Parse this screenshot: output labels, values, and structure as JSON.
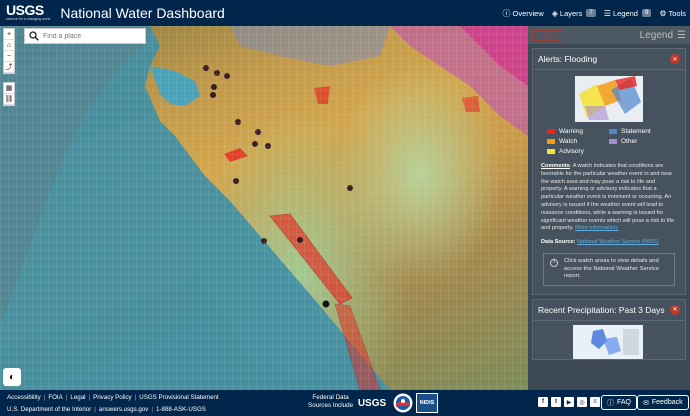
{
  "header": {
    "logo_text": "USGS",
    "logo_tagline": "science for a changing world",
    "title": "National Water Dashboard",
    "nav": [
      {
        "label": "Overview",
        "icon": "info-icon"
      },
      {
        "label": "Layers",
        "icon": "layers-icon",
        "badge": "7"
      },
      {
        "label": "Legend",
        "icon": "legend-icon",
        "badge": "8"
      },
      {
        "label": "Tools",
        "icon": "gear-icon"
      }
    ]
  },
  "search": {
    "placeholder": "Find a place"
  },
  "map_tools": [
    "+",
    "⌂",
    "−",
    "⤴"
  ],
  "sidebar": {
    "close_label": "Close",
    "legend_title": "Legend",
    "alerts": {
      "title": "Alerts: Flooding",
      "legend_items": [
        {
          "label": "Warning",
          "color": "#e8271f"
        },
        {
          "label": "Statement",
          "color": "#4f86c9"
        },
        {
          "label": "Watch",
          "color": "#f39c12"
        },
        {
          "label": "Other",
          "color": "#a78bd3"
        },
        {
          "label": "Advisory",
          "color": "#f4e33b"
        }
      ],
      "comments_label": "Comments",
      "comments_text": ": A watch indicates that conditions are favorable for the particular weather event in and near the watch area and may pose a risk to life and property. A warning or advisory indicates that a particular weather event is imminent or occurring. An advisory is issued if the weather event will lead to nuisance conditions, while a warning is issued for significant weather events which will pose a risk to life and property.",
      "more_info": "More information.",
      "source_label": "Data Source:",
      "source_link": "National Weather Service (NWS)",
      "info_text": "Click watch areas to view details and access the National Weather Service report."
    },
    "precip": {
      "title": "Recent Precipitation: Past 3 Days"
    }
  },
  "footer": {
    "row1": [
      "Accessibility",
      "FOIA",
      "Legal",
      "Privacy Policy",
      "USGS Provisional Statement"
    ],
    "row2": [
      "U.S. Department of the Interior",
      "answers.usgs.gov",
      "1-888-ASK-USGS"
    ],
    "federal_label_1": "Federal Data",
    "federal_label_2": "Sources Include",
    "partner_usgs": "USGS",
    "partner_nidis": "NIDIS",
    "social": [
      "f",
      "t",
      "▶",
      "◎",
      "≡"
    ],
    "faq_label": "FAQ",
    "feedback_label": "Feedback"
  }
}
